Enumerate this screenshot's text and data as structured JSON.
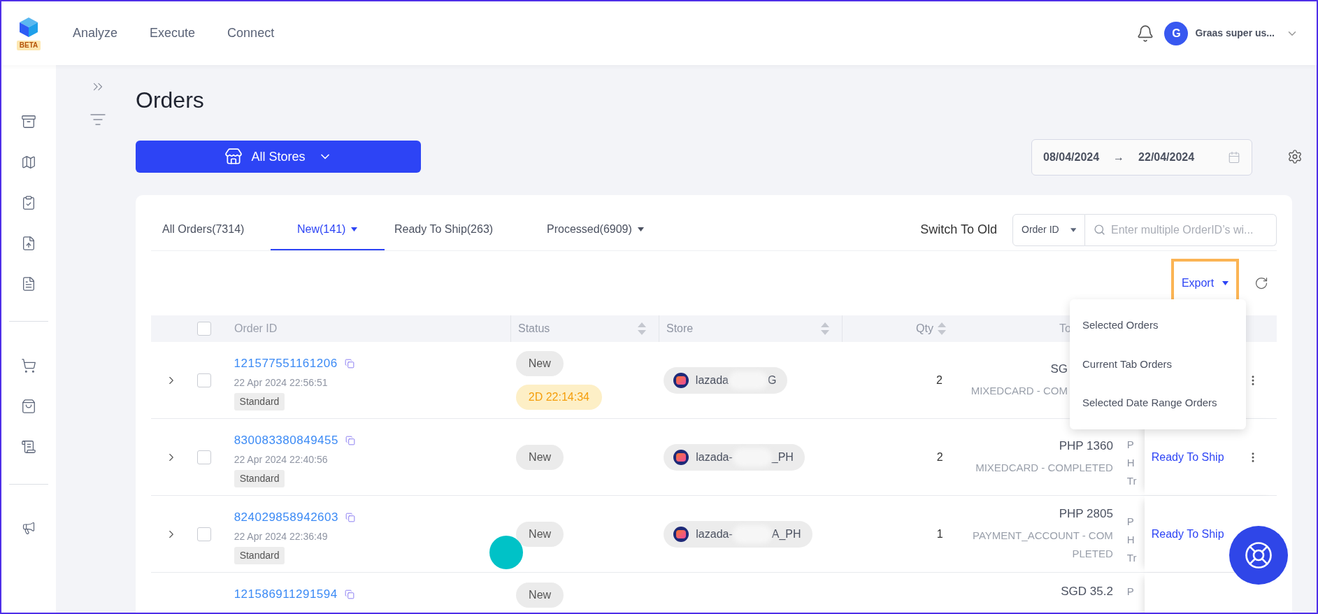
{
  "brand": {
    "badge": "BETA"
  },
  "nav": [
    {
      "label": "Analyze"
    },
    {
      "label": "Execute"
    },
    {
      "label": "Connect"
    }
  ],
  "user": {
    "initial": "G",
    "name": "Graas super us..."
  },
  "page": {
    "title": "Orders"
  },
  "store_picker": {
    "label": "All Stores"
  },
  "date_range": {
    "start": "08/04/2024",
    "arrow": "→",
    "end": "22/04/2024"
  },
  "tabs": [
    {
      "label": "All Orders(7314)",
      "selected": false,
      "dropdown": false
    },
    {
      "label": "New(141)",
      "selected": true,
      "dropdown": true
    },
    {
      "label": "Ready To Ship(263)",
      "selected": false,
      "dropdown": false
    },
    {
      "label": "Processed(6909)",
      "selected": false,
      "dropdown": true
    }
  ],
  "switch_link": "Switch To Old",
  "search": {
    "filter": "Order ID",
    "placeholder": "Enter multiple OrderID’s wi..."
  },
  "export": {
    "label": "Export",
    "highlighted": true,
    "menu": [
      "Selected Orders",
      "Current Tab Orders",
      "Selected Date Range Orders"
    ]
  },
  "table": {
    "header_checked": false,
    "columns": [
      {
        "label": "Order ID",
        "sortable": false
      },
      {
        "label": "Status",
        "sortable": true
      },
      {
        "label": "Store",
        "sortable": true
      },
      {
        "label": "Qty",
        "sortable": true
      },
      {
        "label": "To",
        "sortable": false
      }
    ],
    "rows": [
      {
        "order_id": "121577551161206",
        "date": "22 Apr 2024 22:56:51",
        "type": "Standard",
        "checked": false,
        "statuses": [
          {
            "kind": "status",
            "text": "New"
          },
          {
            "kind": "timer",
            "text": "2D 22:14:34"
          }
        ],
        "store": {
          "prefix": "lazada",
          "suffix": "G"
        },
        "qty": "2",
        "covered": true,
        "total": "SG",
        "payment": "MIXEDCARD - COM",
        "menu": true
      },
      {
        "order_id": "830083380849455",
        "date": "22 Apr 2024 22:40:56",
        "type": "Standard",
        "checked": false,
        "statuses": [
          {
            "kind": "status",
            "text": "New"
          }
        ],
        "store": {
          "prefix": "lazada-",
          "suffix": "_PH"
        },
        "qty": "2",
        "covered": false,
        "total": "PHP 1360",
        "payment": "MIXEDCARD - COMPLETED",
        "column_7": [
          "P",
          "H",
          "Tr"
        ],
        "action": "Ready To Ship",
        "menu": true
      },
      {
        "order_id": "824029858942603",
        "date": "22 Apr 2024 22:36:49",
        "type": "Standard",
        "checked": false,
        "statuses": [
          {
            "kind": "status",
            "text": "New"
          }
        ],
        "store": {
          "prefix": "lazada-",
          "suffix": "A_PH"
        },
        "qty": "1",
        "covered": false,
        "total": "PHP 2805",
        "payment": "PAYMENT_ACCOUNT - COMPLETED",
        "column_7": [
          "P",
          "H",
          "Tr"
        ],
        "action": "Ready To Ship",
        "menu": false
      },
      {
        "order_id": "121586911291594",
        "statuses": [
          {
            "kind": "status",
            "text": "New"
          }
        ],
        "total": "SGD 35.2",
        "column_7": [
          "P"
        ],
        "menu": false
      }
    ]
  }
}
